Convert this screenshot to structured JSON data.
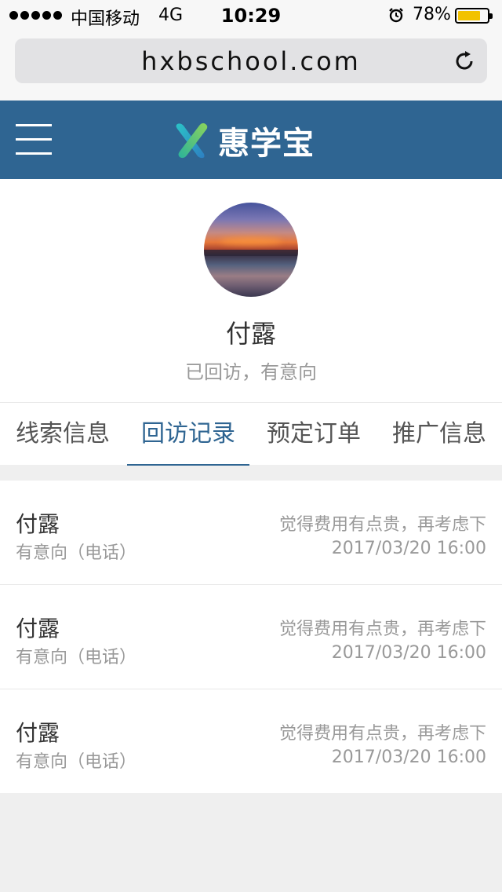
{
  "status_bar": {
    "carrier": "中国移动",
    "network": "4G",
    "time": "10:29",
    "battery_percent": "78%",
    "battery_level": 0.78,
    "battery_color": "#f2c200",
    "alarm_icon": "alarm-clock-icon"
  },
  "browser": {
    "url": "hxbschool.com",
    "reload_icon": "reload-icon"
  },
  "header": {
    "menu_icon": "hamburger-menu-icon",
    "logo_text": "惠学宝",
    "background": "#2f6592"
  },
  "profile": {
    "name": "付露",
    "status": "已回访，有意向"
  },
  "tabs": [
    {
      "label": "线索信息",
      "active": false
    },
    {
      "label": "回访记录",
      "active": true
    },
    {
      "label": "预定订单",
      "active": false
    },
    {
      "label": "推广信息",
      "active": false
    }
  ],
  "records": [
    {
      "name": "付露",
      "type": "有意向（电话）",
      "note": "觉得费用有点贵，再考虑下",
      "time": "2017/03/20  16:00"
    },
    {
      "name": "付露",
      "type": "有意向（电话）",
      "note": "觉得费用有点贵，再考虑下",
      "time": "2017/03/20  16:00"
    },
    {
      "name": "付露",
      "type": "有意向（电话）",
      "note": "觉得费用有点贵，再考虑下",
      "time": "2017/03/20  16:00"
    }
  ]
}
